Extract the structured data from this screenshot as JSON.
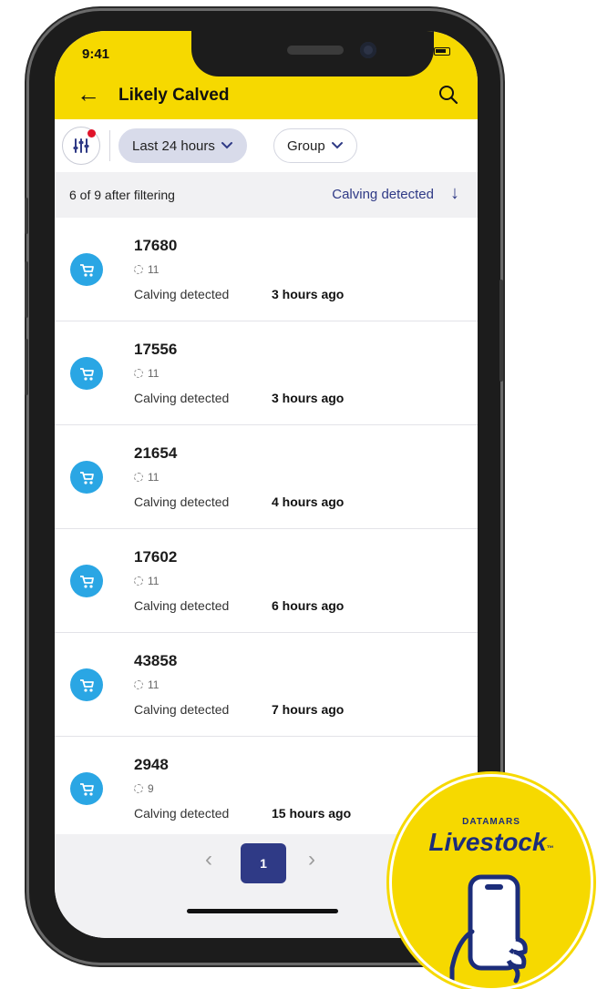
{
  "status_bar": {
    "time": "9:41"
  },
  "header": {
    "title": "Likely Calved",
    "back_icon": "arrow-left-icon",
    "search_icon": "search-icon"
  },
  "filters": {
    "filter_icon": "sliders-icon",
    "chips": [
      {
        "label": "Last 24 hours",
        "active": true
      },
      {
        "label": "Group",
        "active": false
      }
    ]
  },
  "summary": {
    "count_text": "6 of 9 after filtering",
    "sort_label": "Calving detected",
    "sort_icon": "arrow-down-icon"
  },
  "animals": [
    {
      "id": "17680",
      "group": "11",
      "status": "Calving detected",
      "time": "3 hours ago"
    },
    {
      "id": "17556",
      "group": "11",
      "status": "Calving detected",
      "time": "3 hours ago"
    },
    {
      "id": "21654",
      "group": "11",
      "status": "Calving detected",
      "time": "4 hours ago"
    },
    {
      "id": "17602",
      "group": "11",
      "status": "Calving detected",
      "time": "6 hours ago"
    },
    {
      "id": "43858",
      "group": "11",
      "status": "Calving detected",
      "time": "7 hours ago"
    },
    {
      "id": "2948",
      "group": "9",
      "status": "Calving detected",
      "time": "15 hours ago"
    }
  ],
  "pagination": {
    "prev": "‹",
    "current": "1",
    "next": "›"
  },
  "badge": {
    "company": "DATAMARS",
    "product": "Livestock",
    "mark": "™"
  },
  "colors": {
    "accent_yellow": "#f6d900",
    "primary_navy": "#2f3a86",
    "icon_blue": "#2aa6e4",
    "alert_red": "#e0142a"
  }
}
